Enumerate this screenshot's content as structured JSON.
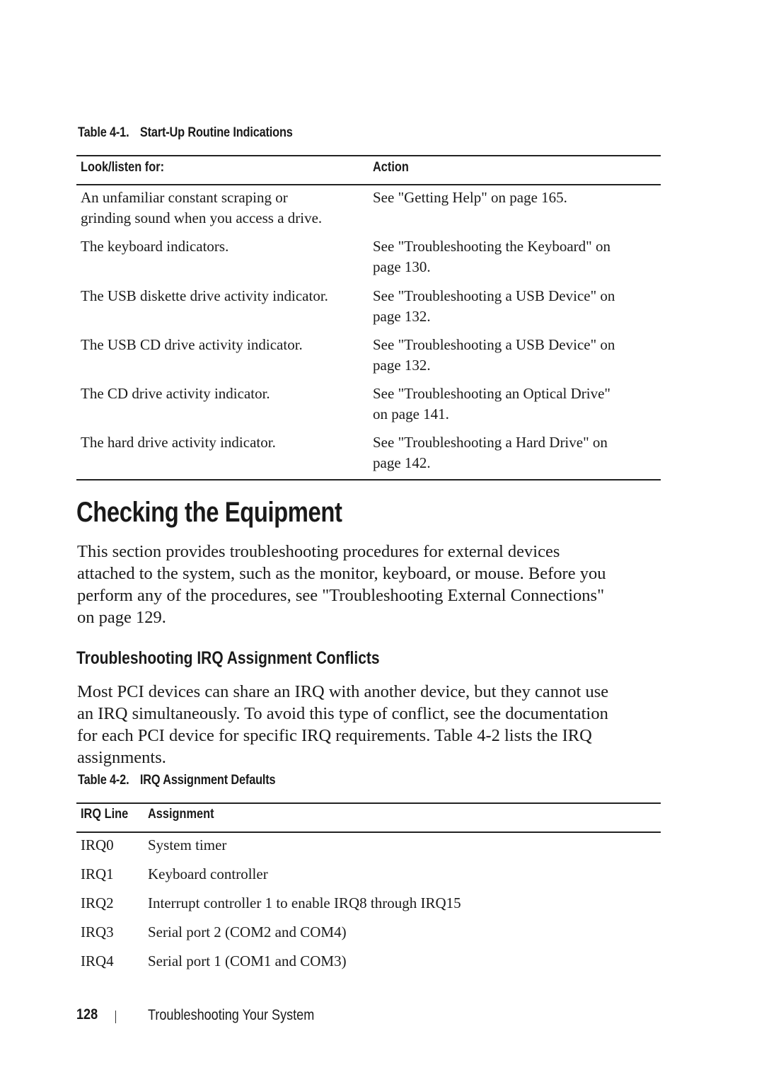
{
  "table1": {
    "label": "Table 4-1.",
    "title": "Start-Up Routine Indications",
    "headers": [
      "Look/listen for:",
      "Action"
    ],
    "rows": [
      {
        "look": [
          "An unfamiliar constant scraping or",
          "grinding sound when you access a drive."
        ],
        "action": [
          "See \"Getting Help\" on page 165.",
          ""
        ]
      },
      {
        "look": [
          "The keyboard indicators.",
          ""
        ],
        "action": [
          "See \"Troubleshooting the Keyboard\" on",
          "page 130."
        ]
      },
      {
        "look": [
          "The USB diskette drive activity indicator.",
          ""
        ],
        "action": [
          "See \"Troubleshooting a USB Device\" on",
          "page 132."
        ]
      },
      {
        "look": [
          "The USB CD drive activity indicator.",
          ""
        ],
        "action": [
          "See \"Troubleshooting a USB Device\" on",
          "page 132."
        ]
      },
      {
        "look": [
          "The CD drive activity indicator.",
          ""
        ],
        "action": [
          "See \"Troubleshooting an Optical Drive\"",
          "on page 141."
        ]
      },
      {
        "look": [
          "The hard drive activity indicator.",
          ""
        ],
        "action": [
          "See \"Troubleshooting a Hard Drive\" on",
          "page 142."
        ]
      }
    ]
  },
  "section": {
    "heading": "Checking the Equipment",
    "paragraph_lines": [
      "This section provides troubleshooting procedures for external devices",
      "attached to the system, such as the monitor, keyboard, or mouse. Before you",
      "perform any of the procedures, see \"Troubleshooting External Connections\"",
      "on page 129."
    ]
  },
  "subsection": {
    "heading": "Troubleshooting IRQ Assignment Conflicts",
    "paragraph_lines": [
      "Most PCI devices can share an IRQ with another device, but they cannot use",
      "an IRQ simultaneously. To avoid this type of conflict, see the documentation",
      "for each PCI device for specific IRQ requirements. Table 4-2 lists the IRQ",
      "assignments."
    ]
  },
  "table2": {
    "label": "Table 4-2.",
    "title": "IRQ Assignment Defaults",
    "headers": [
      "IRQ Line",
      "Assignment"
    ],
    "rows": [
      {
        "line": "IRQ0",
        "assignment": "System timer"
      },
      {
        "line": "IRQ1",
        "assignment": "Keyboard controller"
      },
      {
        "line": "IRQ2",
        "assignment": "Interrupt controller 1 to enable IRQ8 through IRQ15"
      },
      {
        "line": "IRQ3",
        "assignment": "Serial port 2 (COM2 and COM4)"
      },
      {
        "line": "IRQ4",
        "assignment": "Serial port 1 (COM1 and COM3)"
      }
    ]
  },
  "footer": {
    "page_number": "128",
    "chapter_title": "Troubleshooting Your System"
  }
}
